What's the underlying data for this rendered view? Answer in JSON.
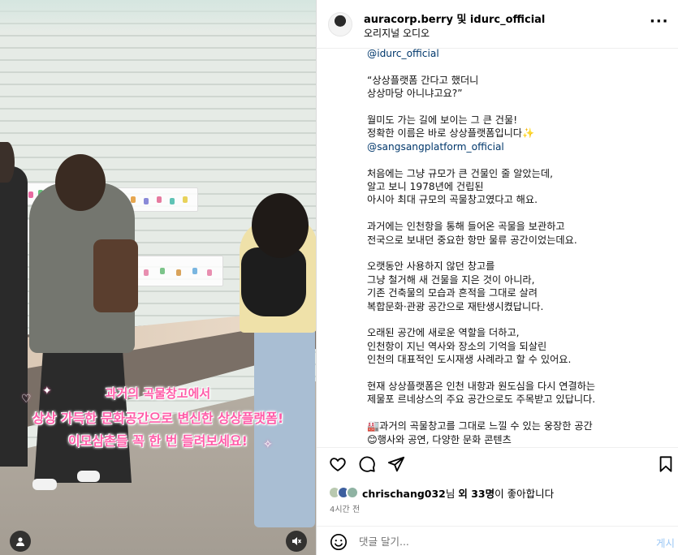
{
  "media": {
    "caption_lines": [
      "과거의 곡물창고에서",
      "상상 가득한 문화공간으로 변신한 상상플랫폼!",
      "이모삼촌들 꼭 한 번 들려보세요!"
    ],
    "user_icon": "user-tag-icon",
    "mute_icon": "speaker-muted-icon"
  },
  "header": {
    "accounts": "auracorp.berry 및 idurc_official",
    "subtitle": "오리지널 오디오",
    "more": "···"
  },
  "post": {
    "paragraphs": [
      [
        "@idurc_official"
      ],
      [
        "“상상플랫폼 간다고 했더니",
        "상상마당 아니냐고요?”"
      ],
      [
        "월미도 가는 길에 보이는 그 큰 건물!",
        "정확한 이름은 바로 상상플랫폼입니다✨",
        "@sangsangplatform_official"
      ],
      [
        "처음에는 그냥 규모가 큰 건물인 줄 알았는데,",
        "알고 보니 1978년에 건립된",
        "아시아 최대 규모의 곡물창고였다고 해요."
      ],
      [
        "과거에는 인천항을 통해 들어온 곡물을 보관하고",
        "전국으로 보내던 중요한 항만 물류 공간이었는데요."
      ],
      [
        "오랫동안 사용하지 않던 창고를",
        "그냥 철거해 새 건물을 지은 것이 아니라,",
        "기존 건축물의 모습과 흔적을 그대로 살려",
        "복합문화·관광 공간으로 재탄생시켰답니다."
      ],
      [
        "오래된 공간에 새로운 역할을 더하고,",
        "인천항이 지닌 역사와 장소의 기억을 되살린",
        "인천의 대표적인 도시재생 사례라고 할 수 있어요."
      ],
      [
        "현재 상상플랫폼은 인천 내항과 원도심을 다시 연결하는",
        "제물포 르네상스의 주요 공간으로도 주목받고 있답니다."
      ],
      [
        "🏭과거의 곡물창고를 그대로 느낄 수 있는 웅장한 공간",
        "😊행사와 공연, 다양한 문화 콘텐츠"
      ]
    ]
  },
  "actions": {
    "like_icon": "heart-icon",
    "comment_icon": "comment-icon",
    "share_icon": "share-icon",
    "save_icon": "bookmark-icon"
  },
  "likes": {
    "user": "chrischang032",
    "mid": "님 ",
    "others": "외 33명",
    "suffix": "이 좋아합니다"
  },
  "time": "4시간 전",
  "comment": {
    "placeholder": "댓글 달기...",
    "post_label": "게시"
  }
}
